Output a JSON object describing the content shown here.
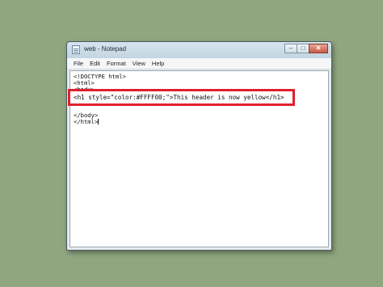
{
  "window": {
    "title": "web - Notepad",
    "buttons": {
      "minimize": "–",
      "maximize": "□",
      "close": "✕"
    }
  },
  "menubar": {
    "items": [
      "File",
      "Edit",
      "Format",
      "View",
      "Help"
    ]
  },
  "editor": {
    "lines": [
      "<!DOCTYPE html>",
      "<html>",
      "<body>",
      "",
      "<h1 style=\"color:#FFFF00;\">This header is now yellow</h1>",
      "</body>",
      "</html>"
    ]
  },
  "highlight": {
    "color": "#e0202e"
  }
}
